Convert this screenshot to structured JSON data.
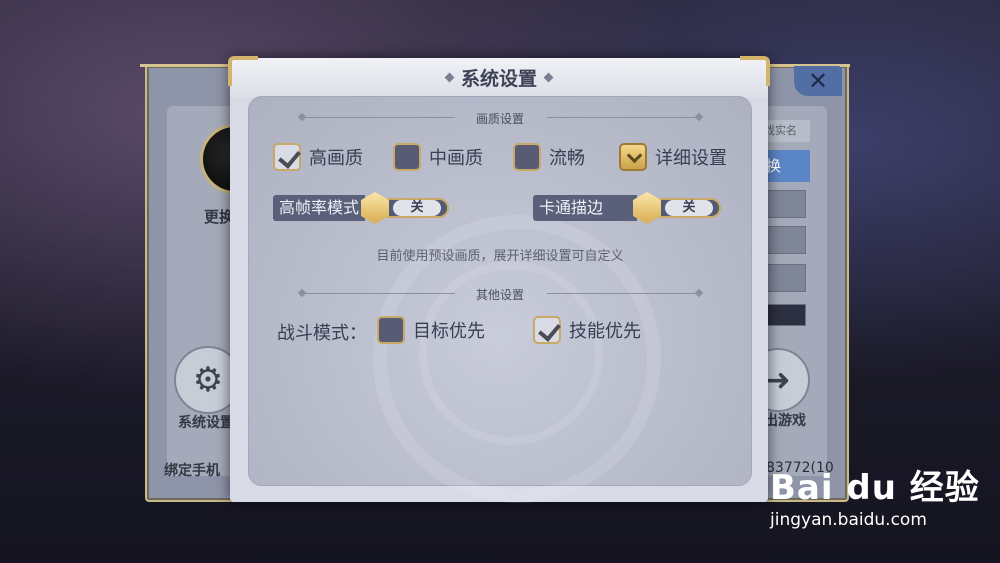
{
  "background_panel": {
    "avatar_label": "更换",
    "settings_button_label": "系统设置",
    "bind_phone_label": "绑定手机",
    "exit_game_label": "退出游戏",
    "id_fragment": "83772(10",
    "real_name_tag": "戏实名",
    "switch_button_label": "换",
    "close_button": "✕"
  },
  "dialog": {
    "title": "系统设置",
    "quality_section": {
      "header": "画质设置",
      "options": [
        {
          "label": "高画质",
          "checked": true
        },
        {
          "label": "中画质",
          "checked": false
        },
        {
          "label": "流畅",
          "checked": false
        },
        {
          "label": "详细设置",
          "expanded": false
        }
      ],
      "toggles": [
        {
          "label": "高帧率模式",
          "state": "关"
        },
        {
          "label": "卡通描边",
          "state": "关"
        }
      ],
      "hint": "目前使用预设画质，展开详细设置可自定义"
    },
    "other_section": {
      "header": "其他设置",
      "battle_mode_label": "战斗模式：",
      "options": [
        {
          "label": "目标优先",
          "checked": false
        },
        {
          "label": "技能优先",
          "checked": true
        }
      ]
    }
  },
  "watermark": {
    "logo": "Bai du 经验",
    "url": "jingyan.baidu.com"
  },
  "colors": {
    "gold_border": "#c8a967",
    "checkbox_dark": "#575c74",
    "dialog_bg": "#d8dbe6"
  }
}
